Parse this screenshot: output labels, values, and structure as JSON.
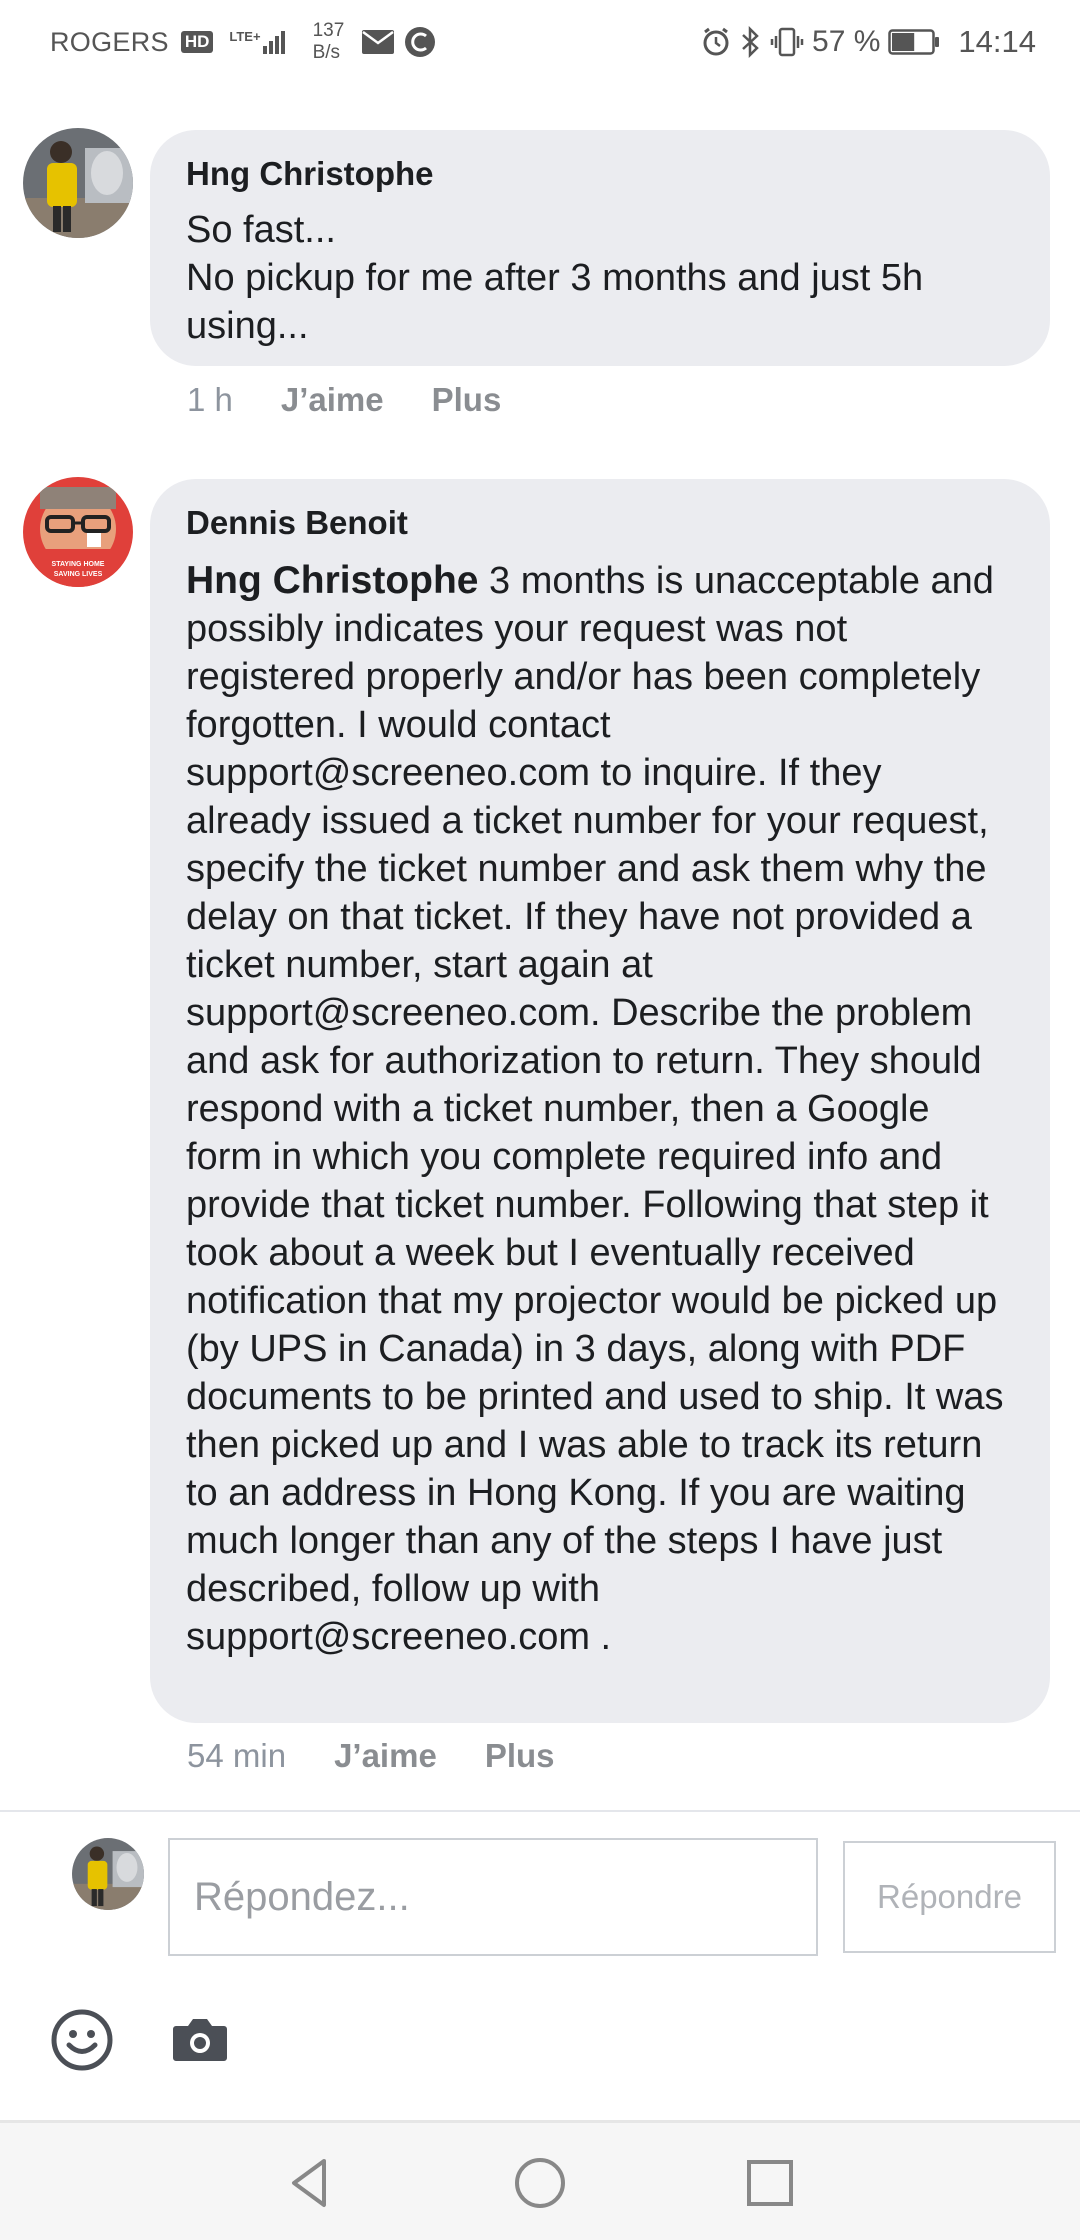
{
  "status_bar": {
    "carrier": "ROGERS",
    "hd": "HD",
    "network": "LTE+",
    "speed_value": "137",
    "speed_unit": "B/s",
    "battery_percent": "57 %",
    "time": "14:14",
    "battery_level": 0.57
  },
  "comments": [
    {
      "author": "Hng Christophe",
      "text": "So fast...\nNo pickup for me after 3 months and just 5h using...",
      "time": "1 h",
      "like": "J’aime",
      "more": "Plus"
    },
    {
      "author": "Dennis Benoit",
      "avatar_caption_line1": "STAYING HOME",
      "avatar_caption_line2": "SAVING LIVES",
      "mention": "Hng Christophe",
      "text": " 3 months is unacceptable and possibly indicates your request was not registered properly and/or has been completely forgotten. I would contact support@screeneo.com to inquire. If they already issued a ticket number for your request, specify the ticket number and ask them why the delay on that ticket. If they have not provided a ticket number, start again at support@screeneo.com. Describe the problem and ask for authorization to return. They should respond with a ticket number, then a Google form in which you complete required info and provide that ticket number. Following that step it took about a week but I eventually received notification that my projector would be picked up (by UPS in Canada) in 3 days, along with PDF documents to be printed and used to ship. It was then picked up and I was able to track its return to an address in Hong Kong. If you are waiting much longer than any of the steps I have just described, follow up with support@screeneo.com .",
      "time": "54 min",
      "like": "J’aime",
      "more": "Plus"
    }
  ],
  "reply": {
    "placeholder": "Répondez...",
    "button": "Répondre"
  },
  "icons": {
    "emoji": "smiley-icon",
    "camera": "camera-icon",
    "back": "back-triangle-icon",
    "home": "home-circle-icon",
    "recents": "recents-square-icon"
  }
}
